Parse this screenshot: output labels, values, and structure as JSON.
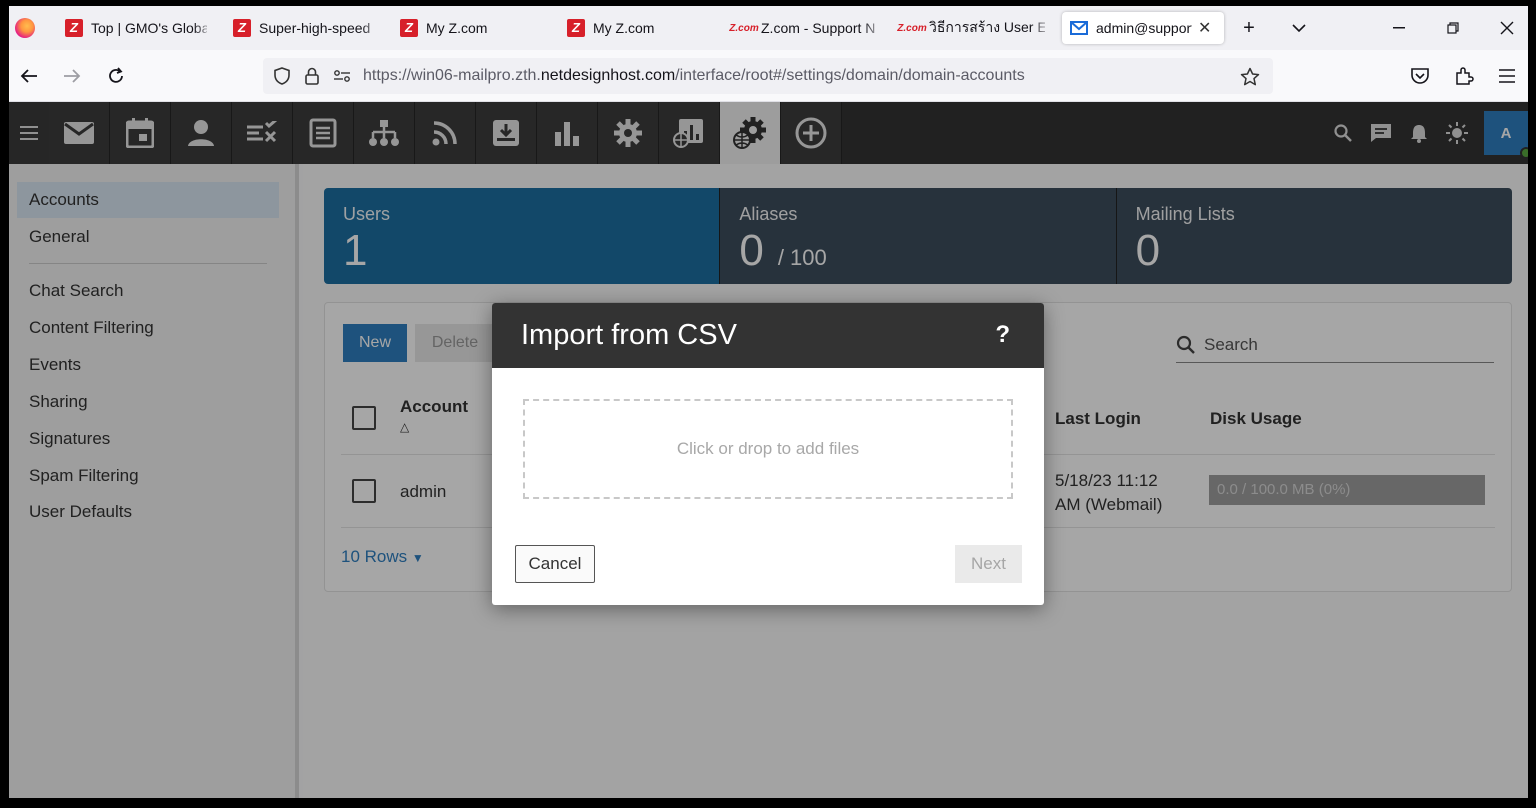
{
  "browser": {
    "tabs": [
      {
        "title": "Top | GMO's Global",
        "favicon": "z-logo-icon"
      },
      {
        "title": "Super-high-speed",
        "favicon": "z-logo-icon"
      },
      {
        "title": "My Z.com",
        "favicon": "z-logo-icon"
      },
      {
        "title": "My Z.com",
        "favicon": "z-logo-icon"
      },
      {
        "title": "Z.com - Support N",
        "favicon": "zcom-text-icon"
      },
      {
        "title": "วิธีการสร้าง User En",
        "favicon": "zcom-text-icon"
      },
      {
        "title": "admin@support",
        "favicon": "mail-icon",
        "active": true
      }
    ],
    "url": {
      "prefix": "https://win06-mailpro.zth.",
      "host": "netdesignhost.com",
      "path": "/interface/root#/settings/domain/domain-accounts"
    }
  },
  "toolbar": {
    "user_initial": "A"
  },
  "sidebar": {
    "items": [
      {
        "label": "Accounts",
        "active": true
      },
      {
        "label": "General"
      },
      {
        "label": "Chat Search"
      },
      {
        "label": "Content Filtering"
      },
      {
        "label": "Events"
      },
      {
        "label": "Sharing"
      },
      {
        "label": "Signatures"
      },
      {
        "label": "Spam Filtering"
      },
      {
        "label": "User Defaults"
      }
    ]
  },
  "stats": {
    "users": {
      "label": "Users",
      "value": "1"
    },
    "aliases": {
      "label": "Aliases",
      "value": "0",
      "max": "/ 100"
    },
    "mailing_lists": {
      "label": "Mailing Lists",
      "value": "0"
    }
  },
  "panel": {
    "new_label": "New",
    "delete_label": "Delete",
    "search_placeholder": "Search",
    "columns": {
      "account": "Account",
      "last_login": "Last Login",
      "disk_usage": "Disk Usage"
    },
    "rows": [
      {
        "account": "admin",
        "last_login_line1": "5/18/23 11:12",
        "last_login_line2": "AM (Webmail)",
        "disk_usage": "0.0 / 100.0 MB (0%)"
      }
    ],
    "rows_per_page": "10 Rows"
  },
  "modal": {
    "title": "Import from CSV",
    "help": "?",
    "dropzone_text": "Click or drop to add files",
    "cancel_label": "Cancel",
    "next_label": "Next"
  },
  "colors": {
    "accent": "#2f7fc0",
    "toolbar_bg": "#333333",
    "users_card": "#1d6fa1",
    "dark_card": "#3d4d5c"
  }
}
